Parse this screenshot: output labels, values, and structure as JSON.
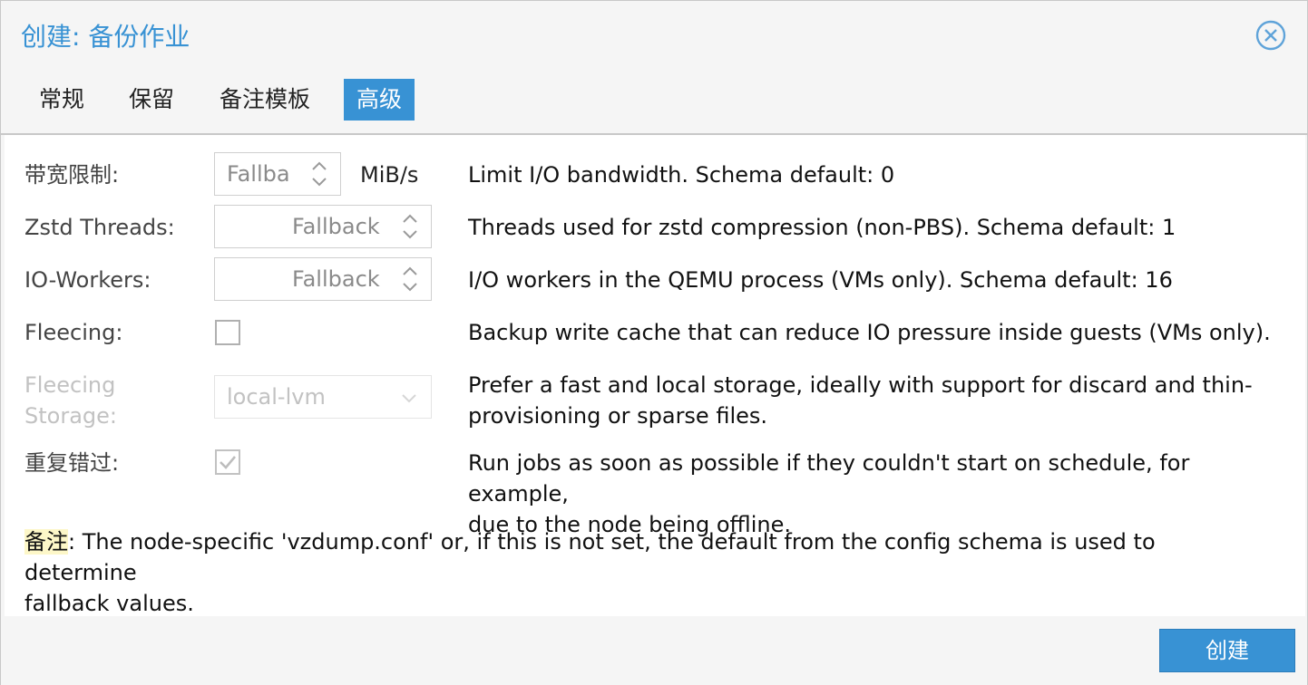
{
  "dialog": {
    "title": "创建: 备份作业",
    "close_icon": "close-circle-icon"
  },
  "tabs": [
    {
      "label": "常规",
      "active": false
    },
    {
      "label": "保留",
      "active": false
    },
    {
      "label": "备注模板",
      "active": false
    },
    {
      "label": "高级",
      "active": true
    }
  ],
  "fields": {
    "bandwidth": {
      "label": "带宽限制:",
      "placeholder": "Fallba",
      "unit": "MiB/s",
      "desc": "Limit I/O bandwidth. Schema default: 0"
    },
    "zstd": {
      "label": "Zstd Threads:",
      "placeholder": "Fallback",
      "desc": "Threads used for zstd compression (non-PBS). Schema default: 1"
    },
    "io_workers": {
      "label": "IO-Workers:",
      "placeholder": "Fallback",
      "desc": "I/O workers in the QEMU process (VMs only). Schema default: 16"
    },
    "fleecing": {
      "label": "Fleecing:",
      "checked": false,
      "desc": "Backup write cache that can reduce IO pressure inside guests (VMs only)."
    },
    "fleecing_storage": {
      "label_line1": "Fleecing",
      "label_line2": "Storage:",
      "value": "local-lvm",
      "disabled": true,
      "desc_line1": "Prefer a fast and local storage, ideally with support for discard and thin-",
      "desc_line2": "provisioning or sparse files."
    },
    "repeat_missed": {
      "label": "重复错过:",
      "checked": true,
      "desc_line1": "Run jobs as soon as possible if they couldn't start on schedule, for example,",
      "desc_line2": "due to the node being offline."
    }
  },
  "note": {
    "prefix": "备注",
    "line1": ": The node-specific 'vzdump.conf' or, if this is not set, the default from the config schema is used to determine",
    "line2": "fallback values."
  },
  "footer": {
    "create_label": "创建"
  },
  "colors": {
    "accent": "#3892d4",
    "note_highlight": "#fdf7c8"
  }
}
